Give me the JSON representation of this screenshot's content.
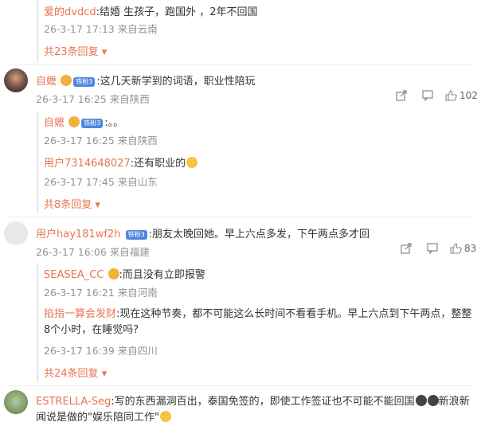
{
  "top_reply": {
    "name": "爱的dvdcd",
    "text": ":结婚 生孩子，跑国外 ，2年不回国",
    "meta": "26-3-17 17:13 来自云南",
    "more": "共23条回复"
  },
  "comment1": {
    "name": "自嬷",
    "badge": "铁粉3",
    "text": ":这几天新学到的词语，职业性陪玩",
    "meta": "26-3-17 16:25 来自陕西",
    "likes": "102",
    "replies": [
      {
        "name": "自嬷",
        "badge": "铁粉3",
        "text": ":。。",
        "meta": "26-3-17 16:25 来自陕西"
      },
      {
        "name": "用户7314648027",
        "text": ":还有职业的",
        "meta": "26-3-17 17:45 来自山东"
      }
    ],
    "more": "共8条回复"
  },
  "comment2": {
    "name": "用户hay181wf2h",
    "badge": "铁粉3",
    "text": ":朋友太晚回她。早上六点多发，下午两点多才回",
    "meta": "26-3-17 16:06 来自福建",
    "likes": "83",
    "replies": [
      {
        "name": "SEASEA_CC",
        "text": ":而且没有立即报警",
        "meta": "26-3-17 16:21 来自河南"
      },
      {
        "name": "掐指一算会发财",
        "text": ":现在这种节奏，都不可能这么长时间不看看手机。早上六点到下午两点，整整",
        "text2": "8个小时，在睡觉吗?",
        "meta": "26-3-17 16:39 来自四川"
      }
    ],
    "more": "共24条回复"
  },
  "comment3": {
    "name": "ESTRELLA-Seg",
    "text": ":写的东西漏洞百出，泰国免签的，即使工作签证也不可能不能回国",
    "text_tail": "新浪新",
    "text2": "闻说是做的\"娱乐陪同工作\""
  },
  "colors": {
    "name": "#eb7350",
    "meta": "#939393",
    "badge": "#4f86e0"
  }
}
